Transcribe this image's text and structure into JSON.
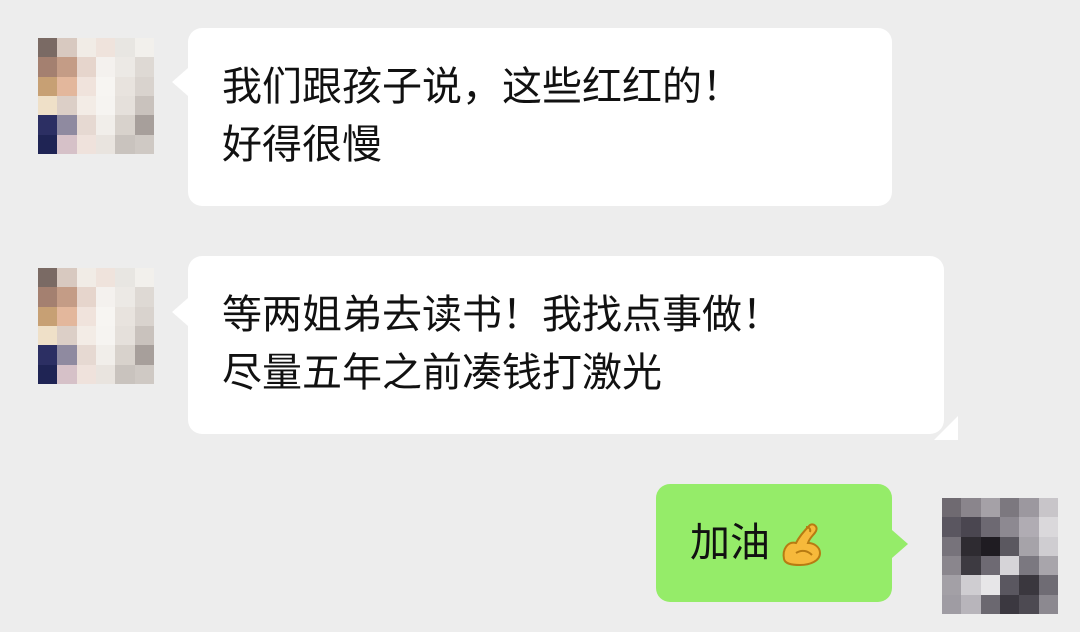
{
  "messages": [
    {
      "direction": "incoming",
      "lines": [
        "我们跟孩子说，这些红红的！",
        "好得很慢"
      ]
    },
    {
      "direction": "incoming",
      "lines": [
        "等两姐弟去读书！我找点事做！",
        "尽量五年之前凑钱打激光"
      ]
    },
    {
      "direction": "outgoing",
      "text": "加油",
      "emoji_icon": "flexed-biceps-icon"
    }
  ],
  "colors": {
    "background": "#ededed",
    "incoming_bubble": "#ffffff",
    "outgoing_bubble": "#95ec69",
    "text": "#111111"
  }
}
